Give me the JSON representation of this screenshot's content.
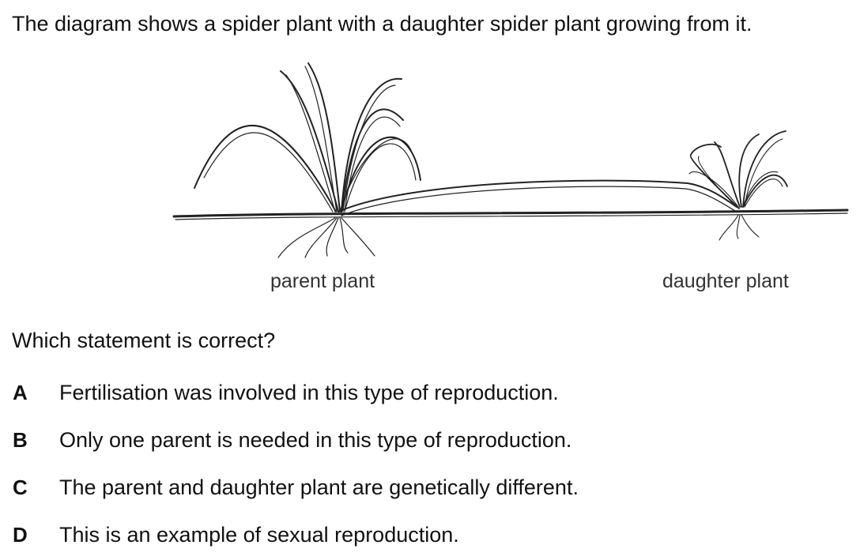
{
  "intro": "The diagram shows a spider plant with a daughter spider plant growing from it.",
  "diagram": {
    "parent_label": "parent plant",
    "daughter_label": "daughter plant"
  },
  "question": "Which statement is correct?",
  "options": [
    {
      "letter": "A",
      "text": "Fertilisation was involved in this type of reproduction."
    },
    {
      "letter": "B",
      "text": "Only one parent is needed in this type of reproduction."
    },
    {
      "letter": "C",
      "text": "The parent and daughter plant are genetically different."
    },
    {
      "letter": "D",
      "text": "This is an example of sexual reproduction."
    }
  ]
}
